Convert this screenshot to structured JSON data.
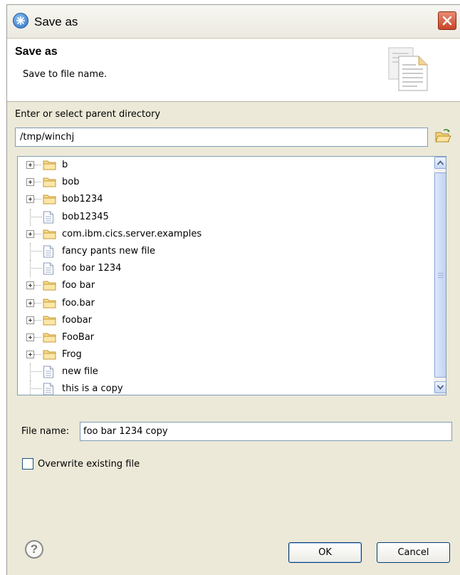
{
  "window": {
    "title": "Save as",
    "close_icon": "close-icon"
  },
  "banner": {
    "title": "Save as",
    "message": "Save to file name.",
    "icon": "documents-icon"
  },
  "parent_directory": {
    "label": "Enter or select parent directory",
    "value": "/tmp/winchj",
    "browse_icon": "open-folder-icon"
  },
  "tree": {
    "items": [
      {
        "label": "b",
        "type": "folder"
      },
      {
        "label": "bob",
        "type": "folder"
      },
      {
        "label": "bob1234",
        "type": "folder"
      },
      {
        "label": "bob12345",
        "type": "file"
      },
      {
        "label": "com.ibm.cics.server.examples",
        "type": "folder"
      },
      {
        "label": "fancy pants new file",
        "type": "file"
      },
      {
        "label": "foo bar 1234",
        "type": "file"
      },
      {
        "label": "foo bar",
        "type": "folder"
      },
      {
        "label": "foo.bar",
        "type": "folder"
      },
      {
        "label": "foobar",
        "type": "folder"
      },
      {
        "label": "FooBar",
        "type": "folder"
      },
      {
        "label": "Frog",
        "type": "folder"
      },
      {
        "label": "new file",
        "type": "file"
      },
      {
        "label": "this is a copy",
        "type": "file"
      }
    ]
  },
  "file_name": {
    "label": "File name:",
    "value": "foo bar 1234 copy"
  },
  "overwrite": {
    "label": "Overwrite existing file",
    "checked": false
  },
  "buttons": {
    "ok": "OK",
    "cancel": "Cancel",
    "help": "?"
  }
}
